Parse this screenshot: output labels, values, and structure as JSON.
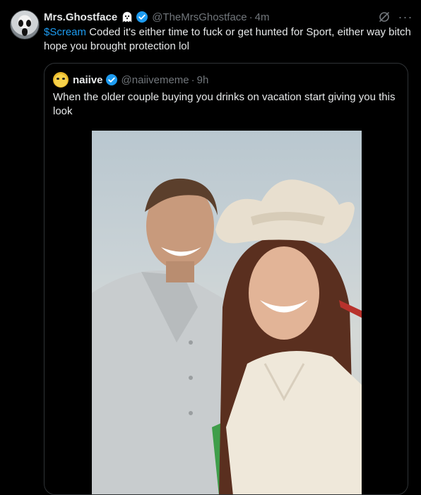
{
  "tweet": {
    "author_name": "Mrs.Ghostface",
    "handle": "@TheMrsGhostface",
    "separator": "·",
    "time": "4m",
    "cashtag": "$Scream",
    "text": " Coded it's either time to fuck or get hunted for Sport, either way bitch hope you brought protection lol",
    "more_label": "···"
  },
  "quoted": {
    "author_name": "naiive",
    "handle": "@naiivememe",
    "separator": "·",
    "time": "9h",
    "text": "When the older couple buying you drinks on vacation start giving you this look"
  },
  "colors": {
    "background": "#000000",
    "text": "#e7e9ea",
    "muted": "#71767b",
    "accent": "#1d9bf0",
    "border": "#2f3336"
  },
  "icons": [
    "ghost-icon",
    "verified-badge-icon",
    "grok-icon",
    "more-icon"
  ]
}
